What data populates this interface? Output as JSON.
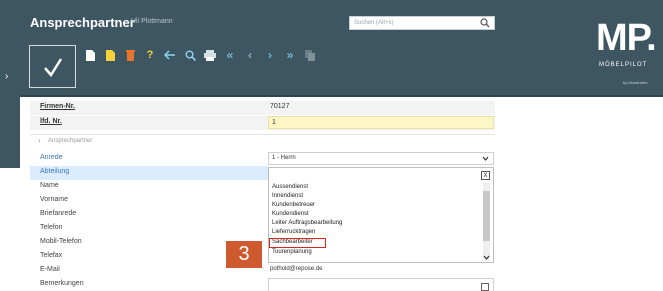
{
  "window": {
    "title": "Ansprechpartner",
    "user": "Uli Plottmann"
  },
  "search": {
    "placeholder": "Suchen (Alt+s)"
  },
  "toolbar": {
    "icons": [
      "new-document-icon",
      "document-yellow-icon",
      "delete-icon",
      "help-icon",
      "back-icon",
      "search-icon",
      "print-icon",
      "first-icon",
      "previous-icon",
      "next-icon",
      "last-icon",
      "copy-icon"
    ]
  },
  "logo": {
    "main": "MP.",
    "sub": "MÖBELPILOT",
    "by": "by Mondrahm"
  },
  "form": {
    "firmen_label": "Firmen-Nr.",
    "firmen_value": "70127",
    "lfd_label": "lfd. Nr.",
    "lfd_value": "1",
    "section_label": "Ansprechpartner",
    "anrede_label": "Anrede",
    "anrede_value": "1 - Herrn",
    "abteilung_label": "Abteilung",
    "name_label": "Name",
    "vorname_label": "Vorname",
    "briefanrede_label": "Briefanrede",
    "telefon_label": "Telefon",
    "mobil_label": "Mobil-Telefon",
    "telefax_label": "Telefax",
    "email_label": "E-Mail",
    "email_value": "pothold@repose.de",
    "bemerkungen_label": "Bemerkungen"
  },
  "dropdown": {
    "close": "X",
    "items": [
      "Aussendienst",
      "Innendienst",
      "Kundenbetreuer",
      "Kundendienst",
      "Leiter Auftragsbearbeitung",
      "Lieferrucktragen",
      "Sachbearbeiter",
      "Tourenplanung"
    ],
    "selected_index": 6
  },
  "step": {
    "number": "3"
  },
  "colors": {
    "header": "#3e5661",
    "accent": "#d05a2f",
    "selection": "#d3281c",
    "highlight": "#fcf7c4",
    "active_row": "#dcecff"
  }
}
